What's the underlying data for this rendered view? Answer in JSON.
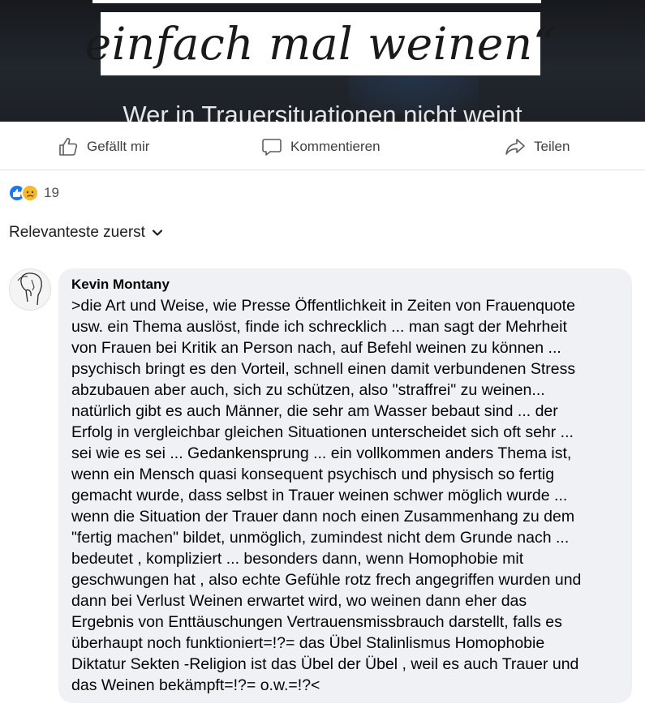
{
  "post_image": {
    "title": "einfach mal weinen“",
    "subtitle": "Wer in Trauersituationen nicht weint"
  },
  "actions": {
    "like_label": "Gefällt mir",
    "comment_label": "Kommentieren",
    "share_label": "Teilen"
  },
  "reactions": {
    "types": [
      "like-icon",
      "sad-face-icon"
    ],
    "count": "19"
  },
  "sort": {
    "label": "Relevanteste zuerst"
  },
  "comment": {
    "author": "Kevin Montany",
    "text": ">die Art und Weise, wie Presse Öffentlichkeit in Zeiten von Frauenquote\nusw. ein Thema auslöst, finde ich schrecklich ... man sagt der Mehrheit\nvon Frauen bei Kritik an Person nach, auf Befehl weinen zu können ...\npsychisch bringt es den Vorteil, schnell einen damit verbundenen Stress\nabzubauen aber auch, sich zu schützen, also \"straffrei\" zu weinen...\nnatürlich gibt es auch Männer, die sehr am Wasser bebaut sind ... der\nErfolg in vergleichbar gleichen Situationen unterscheidet sich oft sehr ...\nsei wie es sei ... Gedankensprung ... ein vollkommen anders Thema ist,\nwenn ein Mensch quasi konsequent psychisch und physisch so fertig\ngemacht wurde, dass selbst in Trauer weinen schwer möglich wurde ...\nwenn die Situation der Trauer dann noch einen Zusammenhang zu dem\n\"fertig machen\" bildet, unmöglich, zumindest nicht dem Grunde nach ...\nbedeutet , kompliziert ... besonders dann, wenn Homophobie mit\ngeschwungen hat , also echte Gefühle rotz frech angegriffen wurden und\ndann bei Verlust Weinen erwartet wird, wo weinen dann eher das\nErgebnis von Enttäuschungen Vertrauensmissbrauch darstellt, falls es\nüberhaupt noch funktioniert=!?= das Übel Stalinlismus Homophobie\nDiktatur Sekten -Religion ist das Übel der Übel , weil es auch Trauer und\ndas Weinen bekämpft=!?= o.w.=!?<"
  },
  "colors": {
    "accent": "#1877f2",
    "sad_reaction": "#f7b928",
    "bubble": "#eff1f4"
  }
}
